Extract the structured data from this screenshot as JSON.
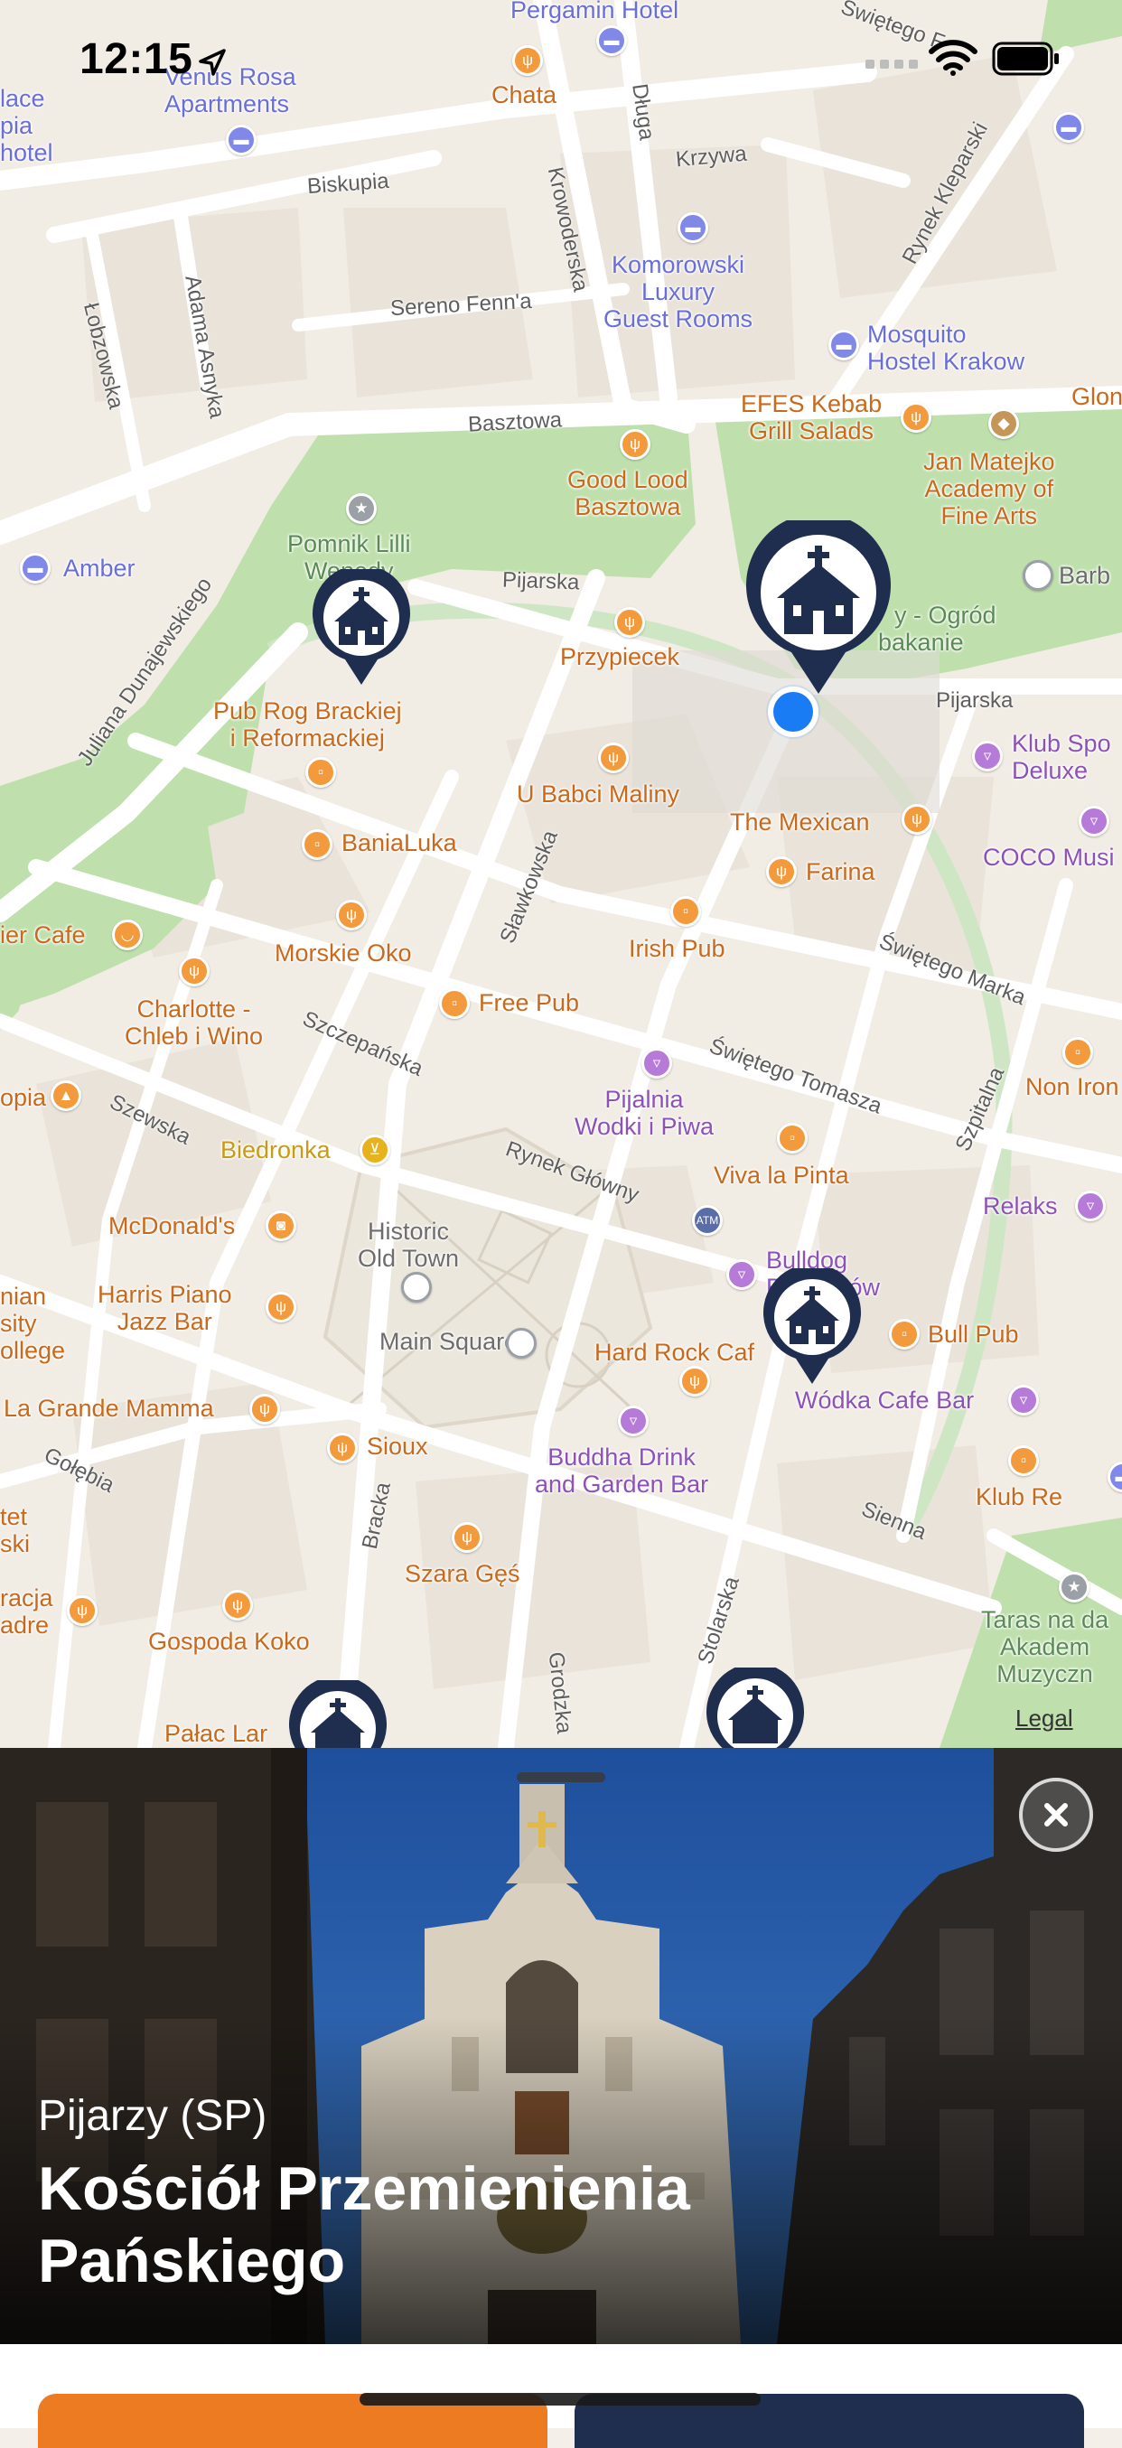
{
  "status_bar": {
    "time": "12:15"
  },
  "map": {
    "legal_label": "Legal",
    "places": {
      "pergamin": "Pergamin Hotel",
      "venus_rosa": "Venus Rosa\nApartments",
      "palace": "lace\npia\nhotel",
      "chata": "Chata",
      "komorowski": "Komorowski\nLuxury\nGuest Rooms",
      "mosquito": "Mosquito\nHostel Krakow",
      "efes": "EFES Kebab\nGrill Salads",
      "glon": "Glon",
      "matejko": "Jan Matejko\nAcademy of\nFine Arts",
      "good_lood": "Good Lood\nBasztowa",
      "pomnik": "Pomnik Lilli\nWenedy",
      "amber": "Amber",
      "barb": "Barb",
      "ogrod": "y\nKa      y - Ogród\np      bakanie",
      "przypiecek": "Przypiecek",
      "pub_rog": "Pub Rog Brackiej\ni Reformackiej",
      "u_babci": "U Babci Maliny",
      "the_mexican": "The Mexican",
      "klub_spo": "Klub Spo\nDeluxe",
      "coco": "COCO Musi",
      "banialuka": "BaniaLuka",
      "farina": "Farina",
      "ier_cafe": "ier Cafe",
      "morskie_oko": "Morskie Oko",
      "irish_pub": "Irish Pub",
      "charlotte": "Charlotte -\nChleb i Wino",
      "free_pub": "Free Pub",
      "non_iron": "Non Iron",
      "pijalnia": "Pijalnia\nWodki i Piwa",
      "opia": "opia",
      "biedronka": "Biedronka",
      "viva_la_pinta": "Viva la Pinta",
      "relaks": "Relaks",
      "mcdonalds": "McDonald's",
      "historic": "Historic\nOld Town",
      "bulldog": "Bulldog\nB      aków",
      "harris": "Harris Piano\nJazz Bar",
      "nian": "nian\nsity\nollege",
      "bull_pub": "Bull Pub",
      "main_square": "Main Square",
      "hard_rock": "Hard Rock Caf",
      "wodka": "Wódka Cafe Bar",
      "grande_mamma": "La Grande Mamma",
      "sioux": "Sioux",
      "buddha": "Buddha Drink\nand Garden Bar",
      "klub_re": "Klub Re",
      "tet": "tet\nski",
      "szara_ges": "Szara Gęś",
      "taras": "Taras na da\nAkadem\nMuzyczn",
      "racja": "racja\nadre",
      "gospoda": "Gospoda Koko",
      "palac": "Pałac Lar"
    },
    "streets": {
      "biskupia": "Biskupia",
      "krzywa": "Krzywa",
      "dluga": "Długa",
      "swietego_f": "Świętego F",
      "krowoderska": "Krowoderska",
      "adama_asnyka": "Adama Asnyka",
      "lobzowska": "Łobzowska",
      "sereno": "Sereno Fenn'a",
      "rynek_kleparski": "Rynek Kleparski",
      "basztowa": "Basztowa",
      "pijarska_1": "Pijarska",
      "pijarska_2": "Pijarska",
      "juliana": "Juliana Dunajewskiego",
      "slawkowska": "Sławkowska",
      "swietego_marka": "Świętego Marka",
      "szczepanska": "Szczepańska",
      "swietego_tomasza": "Świętego Tomasza",
      "szpitalna": "Szpitalna",
      "szewska": "Szewska",
      "rynek_glowny": "Rynek Główny",
      "golebia": "Gołębia",
      "bracka": "Bracka",
      "sienna": "Sienna",
      "stolarska": "Stolarska",
      "grodzka": "Grodzka"
    },
    "atm_label": "ATM"
  },
  "sheet": {
    "subtitle": "Pijarzy (SP)",
    "title": "Kościół Przemienienia Pańskiego"
  },
  "colors": {
    "pin_navy": "#1f2d4f",
    "user_location": "#1a7cf5",
    "accent_orange": "#ec7b22",
    "park_green": "#bfe0ad"
  }
}
